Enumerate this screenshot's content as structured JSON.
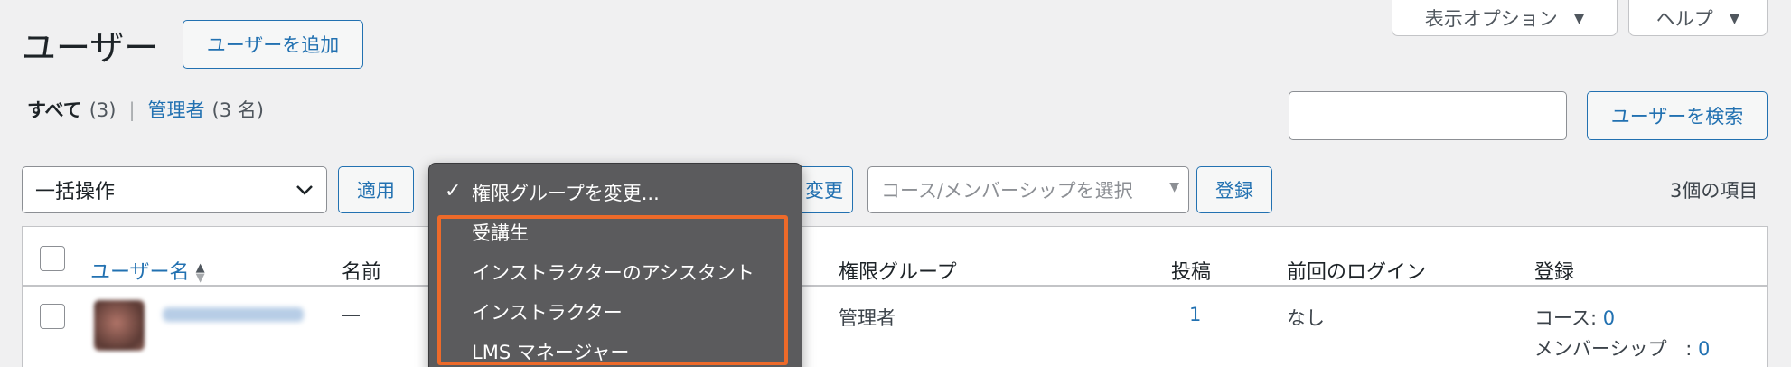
{
  "header": {
    "title": "ユーザー",
    "add_user_label": "ユーザーを追加",
    "screen_options_label": "表示オプション",
    "help_label": "ヘルプ"
  },
  "filters": {
    "all_label": "すべて",
    "all_count": "(3)",
    "separator": "|",
    "admin_label": "管理者",
    "admin_count": "(3 名)"
  },
  "search": {
    "value": "",
    "button_label": "ユーザーを検索"
  },
  "toolbar": {
    "bulk_action_value": "一括操作",
    "apply_label": "適用",
    "change_label_partial": "変更",
    "membership_select_placeholder": "コース/メンバーシップを選択",
    "register_label": "登録",
    "item_count": "3個の項目"
  },
  "role_dropdown": {
    "selected_label": "権限グループを変更...",
    "options": [
      "受講生",
      "インストラクターのアシスタント",
      "インストラクター",
      "LMS マネージャー"
    ]
  },
  "table": {
    "columns": [
      "ユーザー名",
      "名前",
      "権限グループ",
      "投稿",
      "前回のログイン",
      "登録"
    ],
    "rows": [
      {
        "username": "",
        "name": "—",
        "role": "管理者",
        "posts": "1",
        "last_login": "なし",
        "course_label": "コース:",
        "course_count": "0",
        "membership_label": "メンバーシップ",
        "membership_sep": ":",
        "membership_count": "0"
      }
    ]
  },
  "colors": {
    "accent": "#2271b1",
    "highlight": "#ed6a2a",
    "dropdown_bg": "#5b5b5d",
    "page_bg": "#f0f0f1"
  }
}
